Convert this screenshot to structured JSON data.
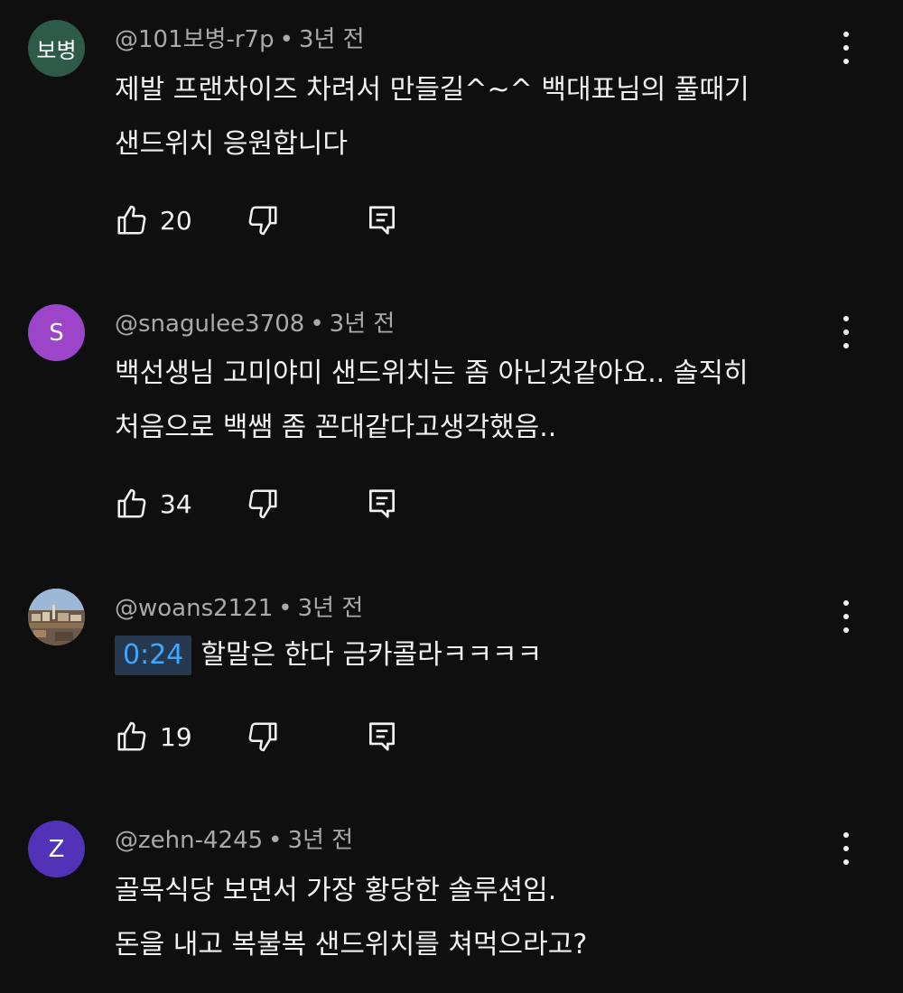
{
  "comments": [
    {
      "author": "@101보병-r7p",
      "age": "3년 전",
      "avatar": {
        "type": "text",
        "text": "보병",
        "color": "#2e5a4a"
      },
      "lines": [
        "제발 프랜차이즈 차려서 만들길^~^ 백대표님의 풀때기",
        "샌드위치 응원합니다"
      ],
      "likes": "20"
    },
    {
      "author": "@snagulee3708",
      "age": "3년 전",
      "avatar": {
        "type": "letter",
        "text": "S",
        "color": "#9c45c9"
      },
      "lines": [
        "백선생님 고미야미 샌드위치는 좀 아닌것같아요.. 솔직히",
        "처음으로 백쌤 좀 꼰대같다고생각했음.."
      ],
      "likes": "34"
    },
    {
      "author": "@woans2121",
      "age": "3년 전",
      "avatar": {
        "type": "photo",
        "text": "",
        "color": "#8aa6c4"
      },
      "timestamp": "0:24",
      "lines": [
        "할말은 한다 금카콜라ㅋㅋㅋㅋ"
      ],
      "likes": "19"
    },
    {
      "author": "@zehn-4245",
      "age": "3년 전",
      "avatar": {
        "type": "letter",
        "text": "Z",
        "color": "#5233b8"
      },
      "lines": [
        "골목식당 보면서 가장 황당한 솔루션임.",
        "돈을 내고 복불복 샌드위치를 쳐먹으라고?"
      ],
      "likes": ""
    }
  ],
  "meta_separator": "•",
  "icons": {
    "like": "thumbs-up-icon",
    "dislike": "thumbs-down-icon",
    "reply": "reply-comment-icon",
    "menu": "more-vertical-icon"
  }
}
